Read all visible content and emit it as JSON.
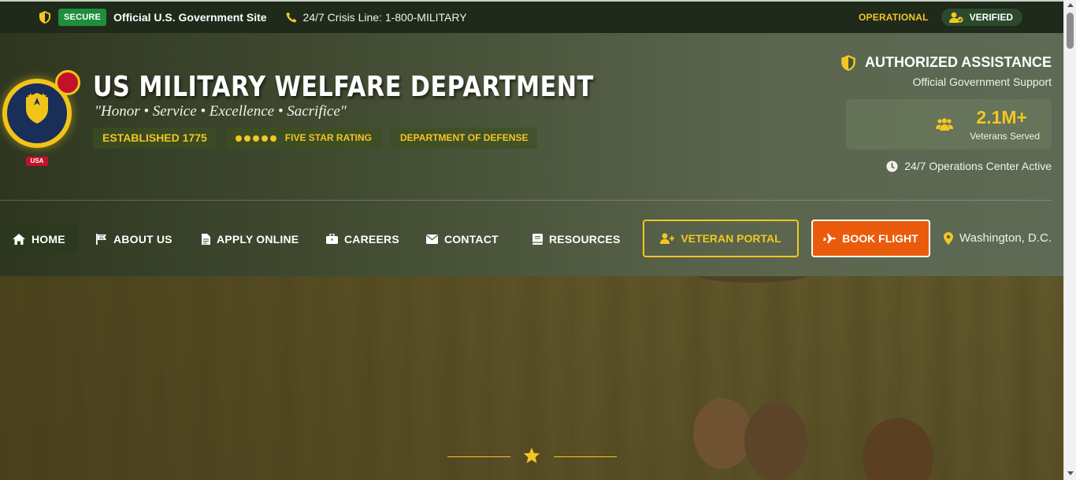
{
  "topbar": {
    "secure_label": "SECURE",
    "gov_label": "Official U.S. Government Site",
    "crisis_label": "24/7 Crisis Line: 1-800-MILITARY",
    "operational_label": "OPERATIONAL",
    "verified_label": "VERIFIED"
  },
  "header": {
    "title": "US MILITARY WELFARE DEPARTMENT",
    "motto": "\"Honor • Service • Excellence • Sacrifice\"",
    "emblem_text": "USA",
    "badges": {
      "established": "ESTABLISHED 1775",
      "rating": "FIVE STAR RATING",
      "department": "DEPARTMENT OF DEFENSE"
    },
    "auth_title": "AUTHORIZED ASSISTANCE",
    "auth_subtitle": "Official Government Support",
    "stat_value": "2.1M+",
    "stat_label": "Veterans Served",
    "ops_label": "24/7 Operations Center Active"
  },
  "nav": {
    "items": [
      {
        "label": "HOME",
        "icon": "home-icon"
      },
      {
        "label": "ABOUT US",
        "icon": "flag-icon"
      },
      {
        "label": "APPLY ONLINE",
        "icon": "document-icon"
      },
      {
        "label": "CAREERS",
        "icon": "briefcase-icon"
      },
      {
        "label": "CONTACT",
        "icon": "envelope-icon"
      },
      {
        "label": "RESOURCES",
        "icon": "book-icon"
      }
    ],
    "portal_label": "VETERAN PORTAL",
    "flight_label": "BOOK FLIGHT",
    "location_label": "Washington, D.C."
  },
  "colors": {
    "accent_gold": "#f3c623",
    "secure_green": "#1e8e3e",
    "flight_orange": "#ea5b0c",
    "emblem_navy": "#1a2e5a",
    "emblem_red": "#c2122b"
  }
}
